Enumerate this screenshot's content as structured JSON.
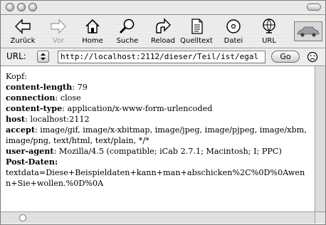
{
  "toolbar": {
    "buttons": [
      {
        "label": "Zurück",
        "icon": "arrow-left-icon",
        "enabled": true
      },
      {
        "label": "Vor",
        "icon": "arrow-right-icon",
        "enabled": false
      },
      {
        "label": "Home",
        "icon": "home-icon",
        "enabled": true
      },
      {
        "label": "Suche",
        "icon": "search-icon",
        "enabled": true
      },
      {
        "label": "Reload",
        "icon": "reload-icon",
        "enabled": true
      },
      {
        "label": "Quelltext",
        "icon": "source-icon",
        "enabled": true
      },
      {
        "label": "Datei",
        "icon": "disk-icon",
        "enabled": true
      },
      {
        "label": "URL",
        "icon": "globe-icon",
        "enabled": true
      }
    ]
  },
  "urlbar": {
    "label": "URL:",
    "value": "http://localhost:2112/dieser/Teil/ist/egal",
    "go_label": "Go",
    "status_icon": "frown-face-icon"
  },
  "content": {
    "intro": "Kopf:",
    "headers": [
      {
        "key": "content-length",
        "value": ": 79"
      },
      {
        "key": "connection",
        "value": ": close"
      },
      {
        "key": "content-type",
        "value": ": application/x-www-form-urlencoded"
      },
      {
        "key": "host",
        "value": ": localhost:2112"
      },
      {
        "key": "accept",
        "value": ": image/gif, image/x-xbitmap, image/jpeg, image/pjpeg, image/xbm, image/png, text/html, text/plain, */*"
      },
      {
        "key": "user-agent",
        "value": ": Mozilla/4.5 (compatible; iCab 2.7.1; Macintosh; I; PPC)"
      }
    ],
    "post_label": "Post-Daten:",
    "post_body": "textdata=Diese+Beispieldaten+kann+man+abschicken%2C%0D%0Awenn+Sie+wollen.%0D%0A"
  }
}
